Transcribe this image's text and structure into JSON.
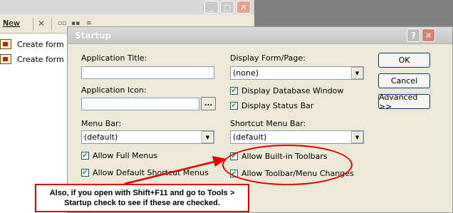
{
  "toolbar": {
    "new_label": "New"
  },
  "list": {
    "items": [
      {
        "label": "Create form in"
      },
      {
        "label": "Create form by"
      }
    ]
  },
  "dialog": {
    "title": "Startup",
    "app_title_label": "Application Title:",
    "app_title_value": "",
    "app_icon_label": "Application Icon:",
    "app_icon_value": "",
    "browse_label": "...",
    "menu_bar_label": "Menu Bar:",
    "menu_bar_value": "(default)",
    "allow_full_menus": "Allow Full Menus",
    "allow_default_shortcut_menus": "Allow Default Shortcut Menus",
    "display_form_label": "Display Form/Page:",
    "display_form_value": "(none)",
    "display_db_window": "Display Database Window",
    "display_status_bar": "Display Status Bar",
    "shortcut_menu_bar_label": "Shortcut Menu Bar:",
    "shortcut_menu_bar_value": "(default)",
    "allow_builtin_toolbars": "Allow Built-in Toolbars",
    "allow_toolbar_menu_changes": "Allow Toolbar/Menu Changes",
    "ok_label": "OK",
    "cancel_label": "Cancel",
    "advanced_label": "Advanced >>",
    "checkboxes_checked": true
  },
  "annotation": {
    "line1": "Also, if you open with Shift+F11 and go to Tools >",
    "line2": "Startup check to see if these are checked.",
    "color": "#e00000"
  }
}
